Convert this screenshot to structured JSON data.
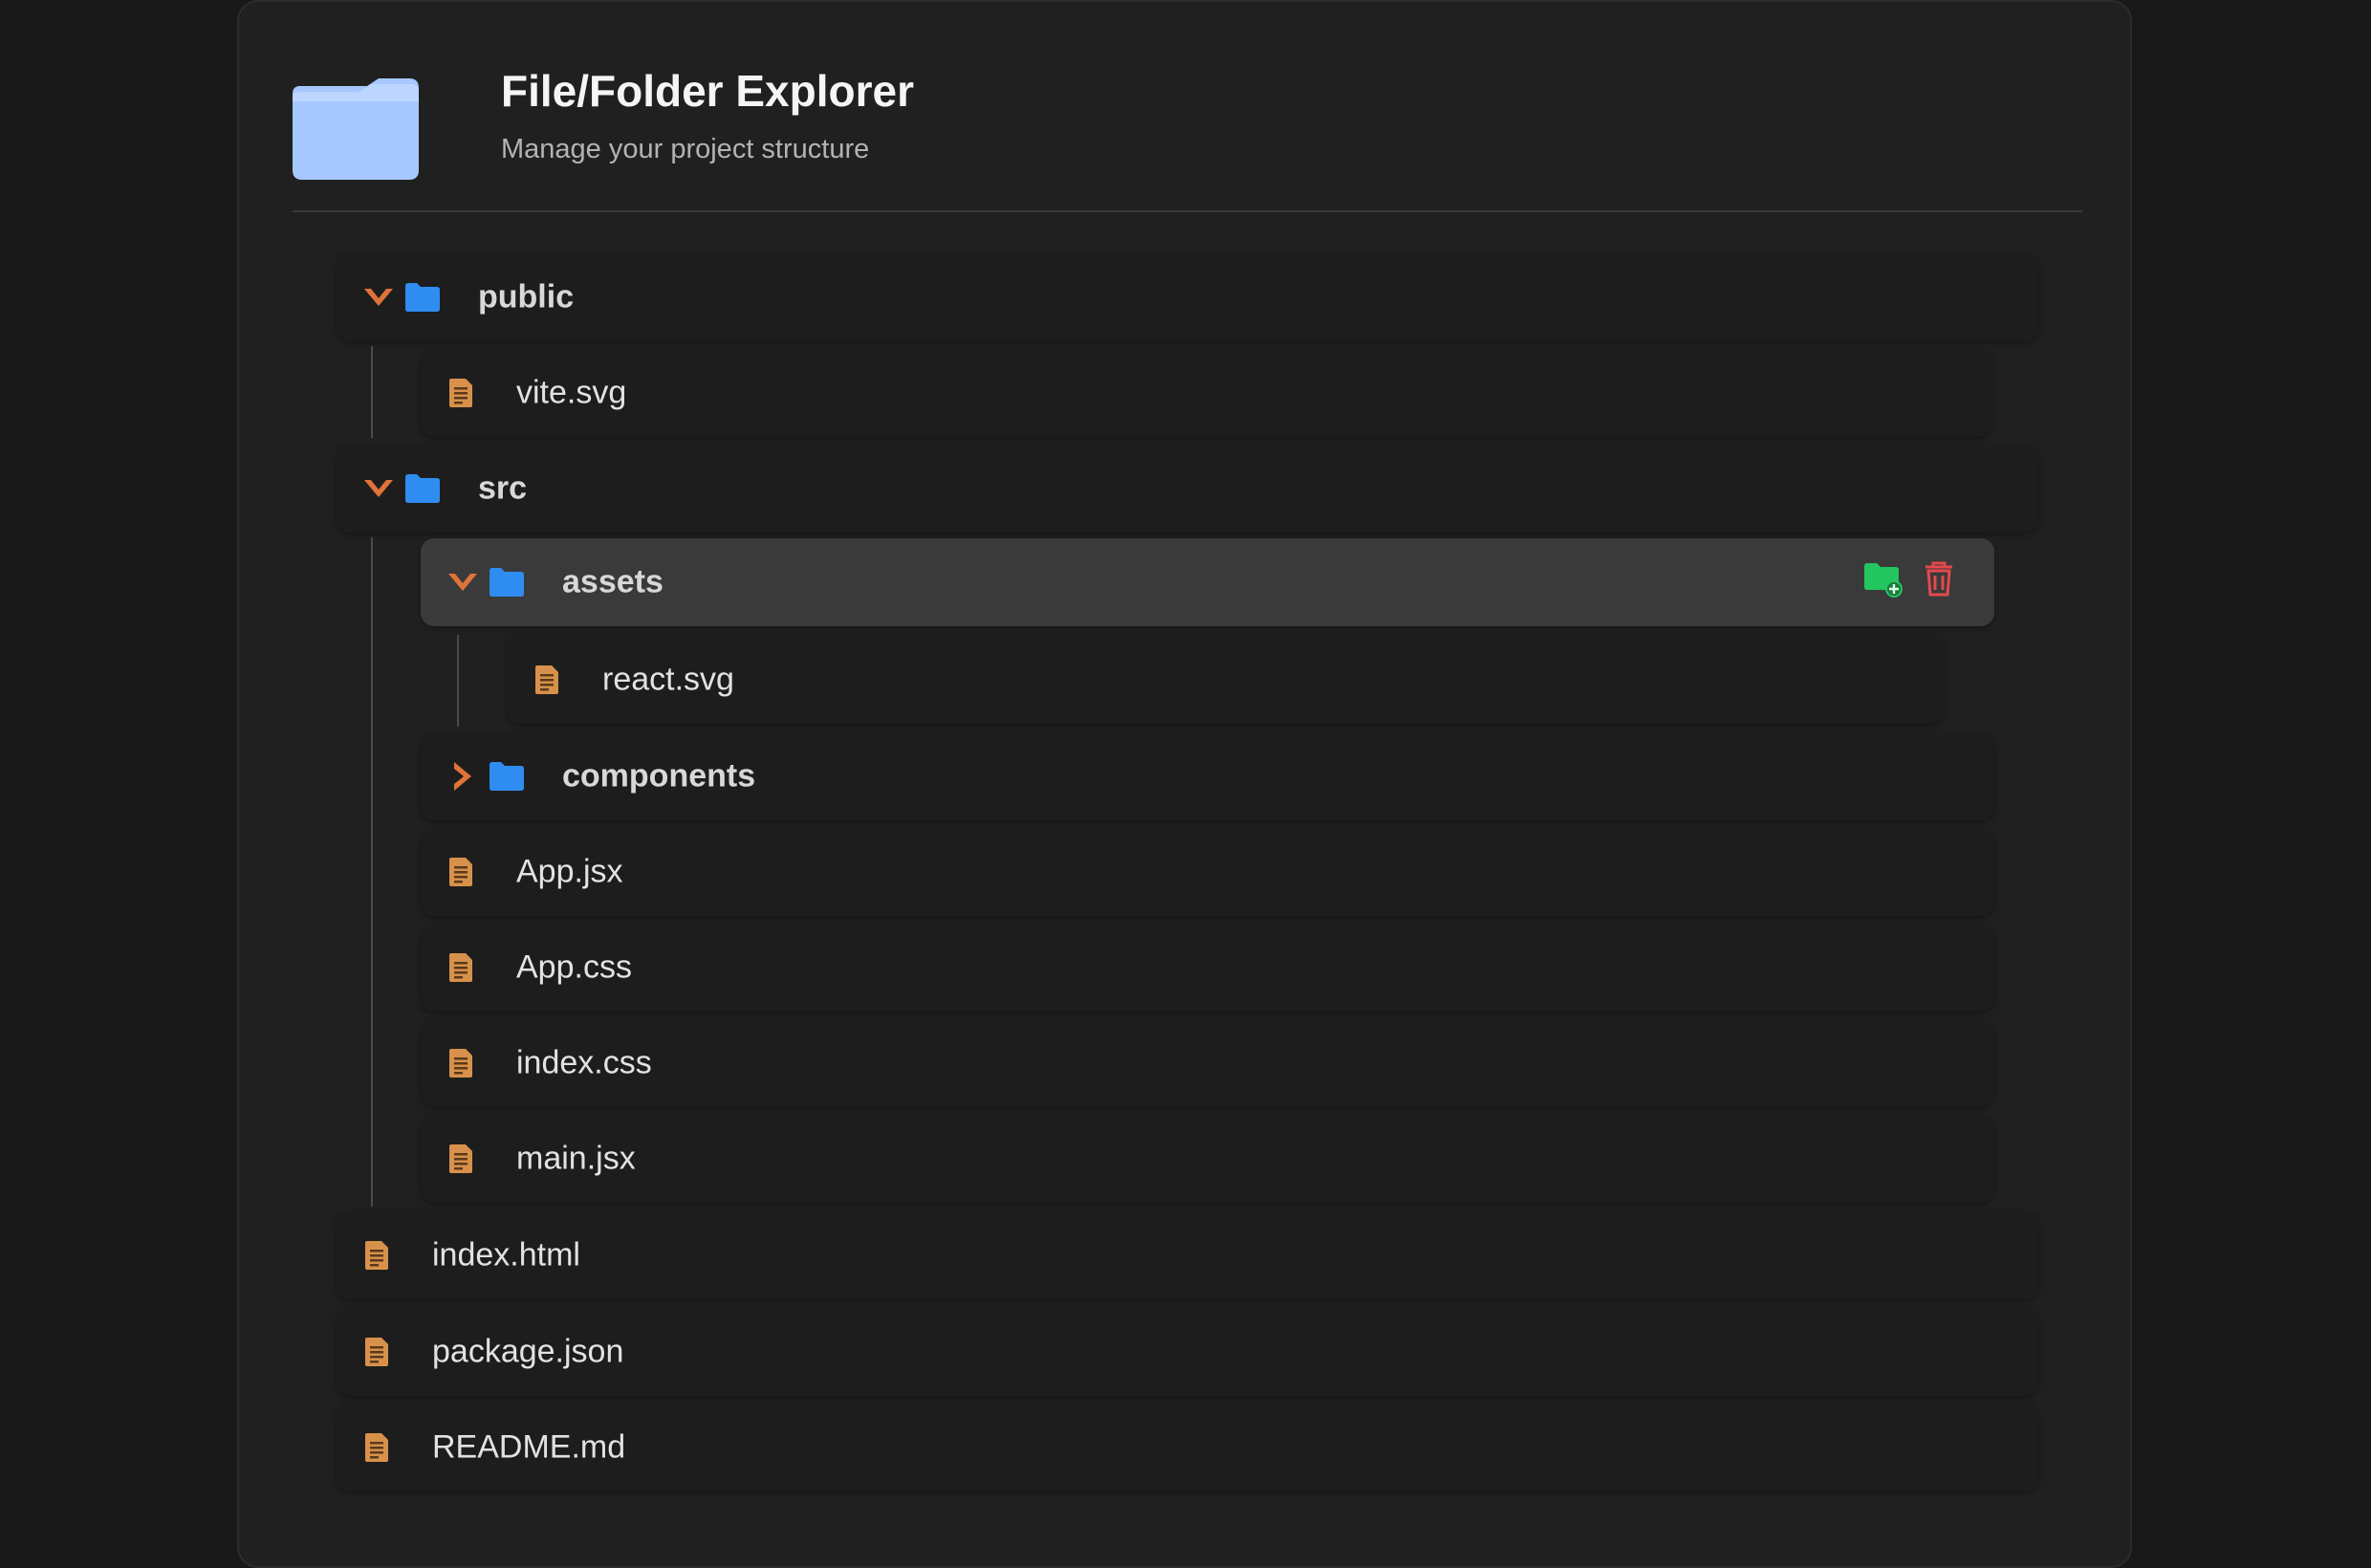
{
  "header": {
    "title": "File/Folder Explorer",
    "subtitle": "Manage your project structure",
    "icon": "folder-icon"
  },
  "colors": {
    "chevron": "#e0733a",
    "folder": "#2f8cf0",
    "file": "#d8914a",
    "header_folder": "#a6c8ff",
    "add_folder": "#22c55e",
    "delete": "#e5484d"
  },
  "tree": {
    "public": {
      "label": "public",
      "expanded": true
    },
    "vite_svg": {
      "label": "vite.svg"
    },
    "src": {
      "label": "src",
      "expanded": true
    },
    "assets": {
      "label": "assets",
      "expanded": true,
      "selected": true,
      "actions": [
        "add-folder-icon",
        "trash-icon"
      ]
    },
    "react_svg": {
      "label": "react.svg"
    },
    "components": {
      "label": "components",
      "expanded": false
    },
    "app_jsx": {
      "label": "App.jsx"
    },
    "app_css": {
      "label": "App.css"
    },
    "index_css": {
      "label": "index.css"
    },
    "main_jsx": {
      "label": "main.jsx"
    },
    "index_html": {
      "label": "index.html"
    },
    "package_json": {
      "label": "package.json"
    },
    "readme": {
      "label": "README.md"
    }
  }
}
